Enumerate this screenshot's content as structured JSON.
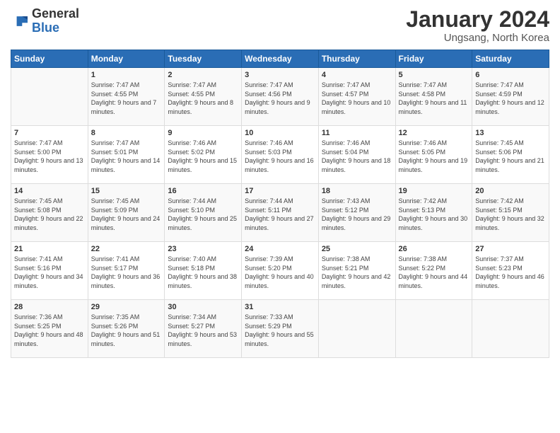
{
  "header": {
    "logo_general": "General",
    "logo_blue": "Blue",
    "month": "January 2024",
    "location": "Ungsang, North Korea"
  },
  "days_of_week": [
    "Sunday",
    "Monday",
    "Tuesday",
    "Wednesday",
    "Thursday",
    "Friday",
    "Saturday"
  ],
  "weeks": [
    [
      {
        "day": "",
        "sunrise": "",
        "sunset": "",
        "daylight": ""
      },
      {
        "day": "1",
        "sunrise": "Sunrise: 7:47 AM",
        "sunset": "Sunset: 4:55 PM",
        "daylight": "Daylight: 9 hours and 7 minutes."
      },
      {
        "day": "2",
        "sunrise": "Sunrise: 7:47 AM",
        "sunset": "Sunset: 4:55 PM",
        "daylight": "Daylight: 9 hours and 8 minutes."
      },
      {
        "day": "3",
        "sunrise": "Sunrise: 7:47 AM",
        "sunset": "Sunset: 4:56 PM",
        "daylight": "Daylight: 9 hours and 9 minutes."
      },
      {
        "day": "4",
        "sunrise": "Sunrise: 7:47 AM",
        "sunset": "Sunset: 4:57 PM",
        "daylight": "Daylight: 9 hours and 10 minutes."
      },
      {
        "day": "5",
        "sunrise": "Sunrise: 7:47 AM",
        "sunset": "Sunset: 4:58 PM",
        "daylight": "Daylight: 9 hours and 11 minutes."
      },
      {
        "day": "6",
        "sunrise": "Sunrise: 7:47 AM",
        "sunset": "Sunset: 4:59 PM",
        "daylight": "Daylight: 9 hours and 12 minutes."
      }
    ],
    [
      {
        "day": "7",
        "sunrise": "Sunrise: 7:47 AM",
        "sunset": "Sunset: 5:00 PM",
        "daylight": "Daylight: 9 hours and 13 minutes."
      },
      {
        "day": "8",
        "sunrise": "Sunrise: 7:47 AM",
        "sunset": "Sunset: 5:01 PM",
        "daylight": "Daylight: 9 hours and 14 minutes."
      },
      {
        "day": "9",
        "sunrise": "Sunrise: 7:46 AM",
        "sunset": "Sunset: 5:02 PM",
        "daylight": "Daylight: 9 hours and 15 minutes."
      },
      {
        "day": "10",
        "sunrise": "Sunrise: 7:46 AM",
        "sunset": "Sunset: 5:03 PM",
        "daylight": "Daylight: 9 hours and 16 minutes."
      },
      {
        "day": "11",
        "sunrise": "Sunrise: 7:46 AM",
        "sunset": "Sunset: 5:04 PM",
        "daylight": "Daylight: 9 hours and 18 minutes."
      },
      {
        "day": "12",
        "sunrise": "Sunrise: 7:46 AM",
        "sunset": "Sunset: 5:05 PM",
        "daylight": "Daylight: 9 hours and 19 minutes."
      },
      {
        "day": "13",
        "sunrise": "Sunrise: 7:45 AM",
        "sunset": "Sunset: 5:06 PM",
        "daylight": "Daylight: 9 hours and 21 minutes."
      }
    ],
    [
      {
        "day": "14",
        "sunrise": "Sunrise: 7:45 AM",
        "sunset": "Sunset: 5:08 PM",
        "daylight": "Daylight: 9 hours and 22 minutes."
      },
      {
        "day": "15",
        "sunrise": "Sunrise: 7:45 AM",
        "sunset": "Sunset: 5:09 PM",
        "daylight": "Daylight: 9 hours and 24 minutes."
      },
      {
        "day": "16",
        "sunrise": "Sunrise: 7:44 AM",
        "sunset": "Sunset: 5:10 PM",
        "daylight": "Daylight: 9 hours and 25 minutes."
      },
      {
        "day": "17",
        "sunrise": "Sunrise: 7:44 AM",
        "sunset": "Sunset: 5:11 PM",
        "daylight": "Daylight: 9 hours and 27 minutes."
      },
      {
        "day": "18",
        "sunrise": "Sunrise: 7:43 AM",
        "sunset": "Sunset: 5:12 PM",
        "daylight": "Daylight: 9 hours and 29 minutes."
      },
      {
        "day": "19",
        "sunrise": "Sunrise: 7:42 AM",
        "sunset": "Sunset: 5:13 PM",
        "daylight": "Daylight: 9 hours and 30 minutes."
      },
      {
        "day": "20",
        "sunrise": "Sunrise: 7:42 AM",
        "sunset": "Sunset: 5:15 PM",
        "daylight": "Daylight: 9 hours and 32 minutes."
      }
    ],
    [
      {
        "day": "21",
        "sunrise": "Sunrise: 7:41 AM",
        "sunset": "Sunset: 5:16 PM",
        "daylight": "Daylight: 9 hours and 34 minutes."
      },
      {
        "day": "22",
        "sunrise": "Sunrise: 7:41 AM",
        "sunset": "Sunset: 5:17 PM",
        "daylight": "Daylight: 9 hours and 36 minutes."
      },
      {
        "day": "23",
        "sunrise": "Sunrise: 7:40 AM",
        "sunset": "Sunset: 5:18 PM",
        "daylight": "Daylight: 9 hours and 38 minutes."
      },
      {
        "day": "24",
        "sunrise": "Sunrise: 7:39 AM",
        "sunset": "Sunset: 5:20 PM",
        "daylight": "Daylight: 9 hours and 40 minutes."
      },
      {
        "day": "25",
        "sunrise": "Sunrise: 7:38 AM",
        "sunset": "Sunset: 5:21 PM",
        "daylight": "Daylight: 9 hours and 42 minutes."
      },
      {
        "day": "26",
        "sunrise": "Sunrise: 7:38 AM",
        "sunset": "Sunset: 5:22 PM",
        "daylight": "Daylight: 9 hours and 44 minutes."
      },
      {
        "day": "27",
        "sunrise": "Sunrise: 7:37 AM",
        "sunset": "Sunset: 5:23 PM",
        "daylight": "Daylight: 9 hours and 46 minutes."
      }
    ],
    [
      {
        "day": "28",
        "sunrise": "Sunrise: 7:36 AM",
        "sunset": "Sunset: 5:25 PM",
        "daylight": "Daylight: 9 hours and 48 minutes."
      },
      {
        "day": "29",
        "sunrise": "Sunrise: 7:35 AM",
        "sunset": "Sunset: 5:26 PM",
        "daylight": "Daylight: 9 hours and 51 minutes."
      },
      {
        "day": "30",
        "sunrise": "Sunrise: 7:34 AM",
        "sunset": "Sunset: 5:27 PM",
        "daylight": "Daylight: 9 hours and 53 minutes."
      },
      {
        "day": "31",
        "sunrise": "Sunrise: 7:33 AM",
        "sunset": "Sunset: 5:29 PM",
        "daylight": "Daylight: 9 hours and 55 minutes."
      },
      {
        "day": "",
        "sunrise": "",
        "sunset": "",
        "daylight": ""
      },
      {
        "day": "",
        "sunrise": "",
        "sunset": "",
        "daylight": ""
      },
      {
        "day": "",
        "sunrise": "",
        "sunset": "",
        "daylight": ""
      }
    ]
  ]
}
